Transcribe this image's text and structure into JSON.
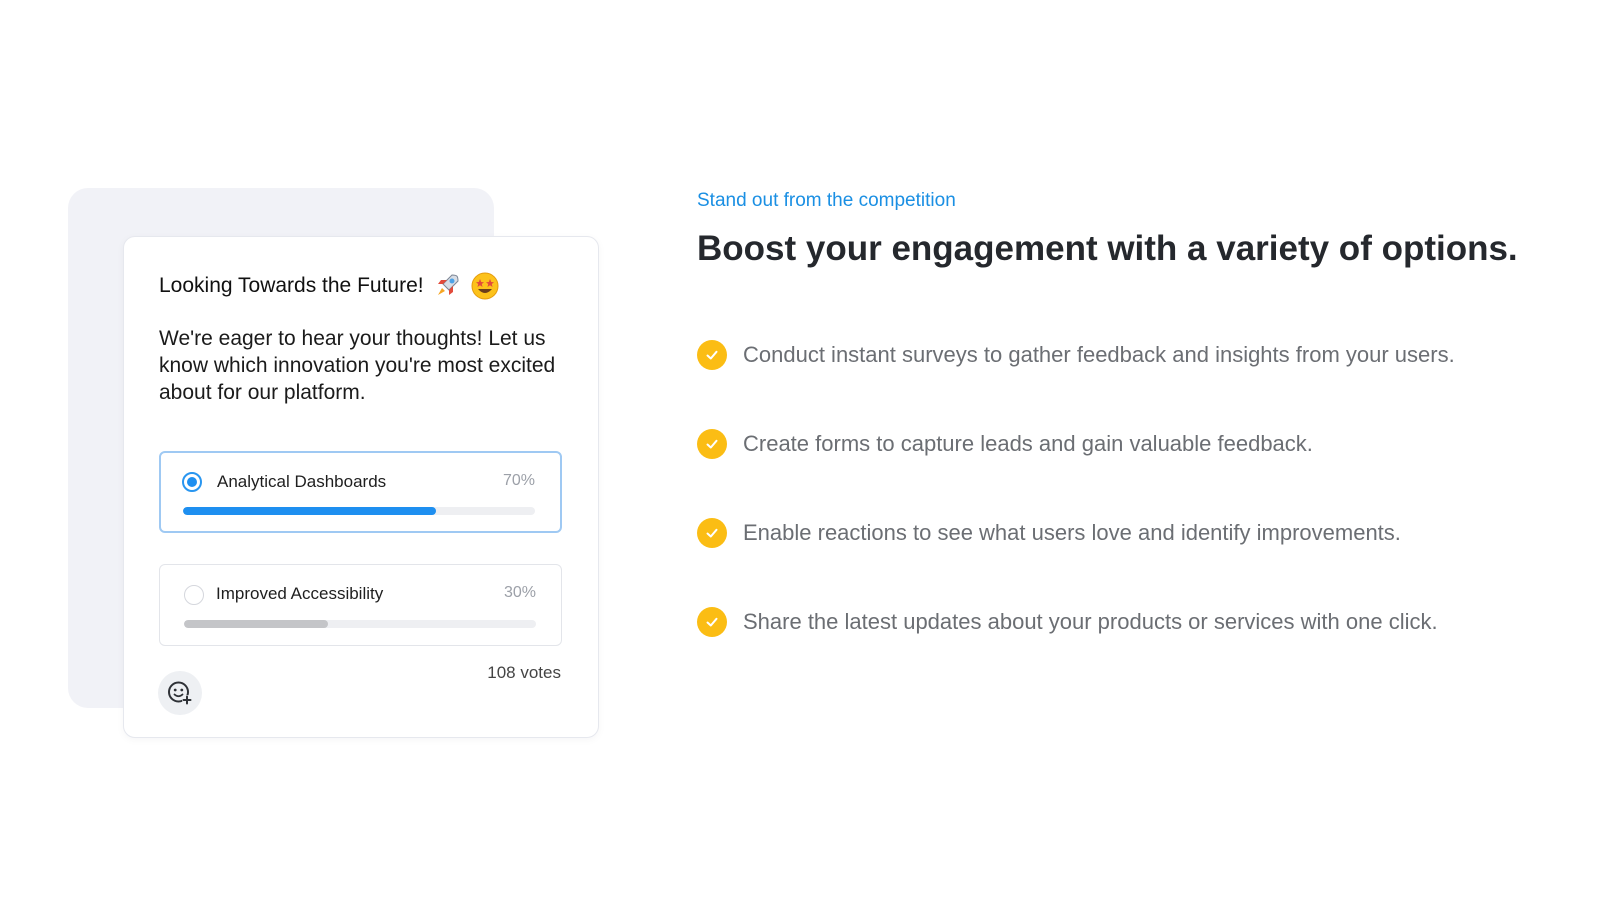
{
  "poll": {
    "title": "Looking Towards the Future!",
    "title_icons": [
      "rocket-icon",
      "star-struck-face-icon"
    ],
    "description": "We're eager to hear your thoughts! Let us know which innovation you're most excited about for our platform.",
    "options": [
      {
        "label": "Analytical Dashboards",
        "percent_label": "70%",
        "fill_percent": 72,
        "selected": true
      },
      {
        "label": "Improved Accessibility",
        "percent_label": "30%",
        "fill_percent": 41,
        "selected": false
      }
    ],
    "votes": "108 votes",
    "reaction_icon": "add-reaction-icon"
  },
  "marketing": {
    "eyebrow": "Stand out from the competition",
    "headline": "Boost your engagement with a variety of options.",
    "features": [
      {
        "icon": "check-circle-icon",
        "text": "Conduct instant surveys to gather feedback and insights from your users."
      },
      {
        "icon": "check-circle-icon",
        "text": "Create forms to capture leads and gain valuable feedback."
      },
      {
        "icon": "check-circle-icon",
        "text": "Enable reactions to see what users love and identify improvements."
      },
      {
        "icon": "check-circle-icon",
        "text": "Share the latest updates about your products or services with one click."
      }
    ]
  },
  "colors": {
    "accent_blue": "#1e8ff0",
    "check_yellow": "#fbbd14",
    "headline": "#25282d",
    "body_gray": "#6b6e73"
  }
}
